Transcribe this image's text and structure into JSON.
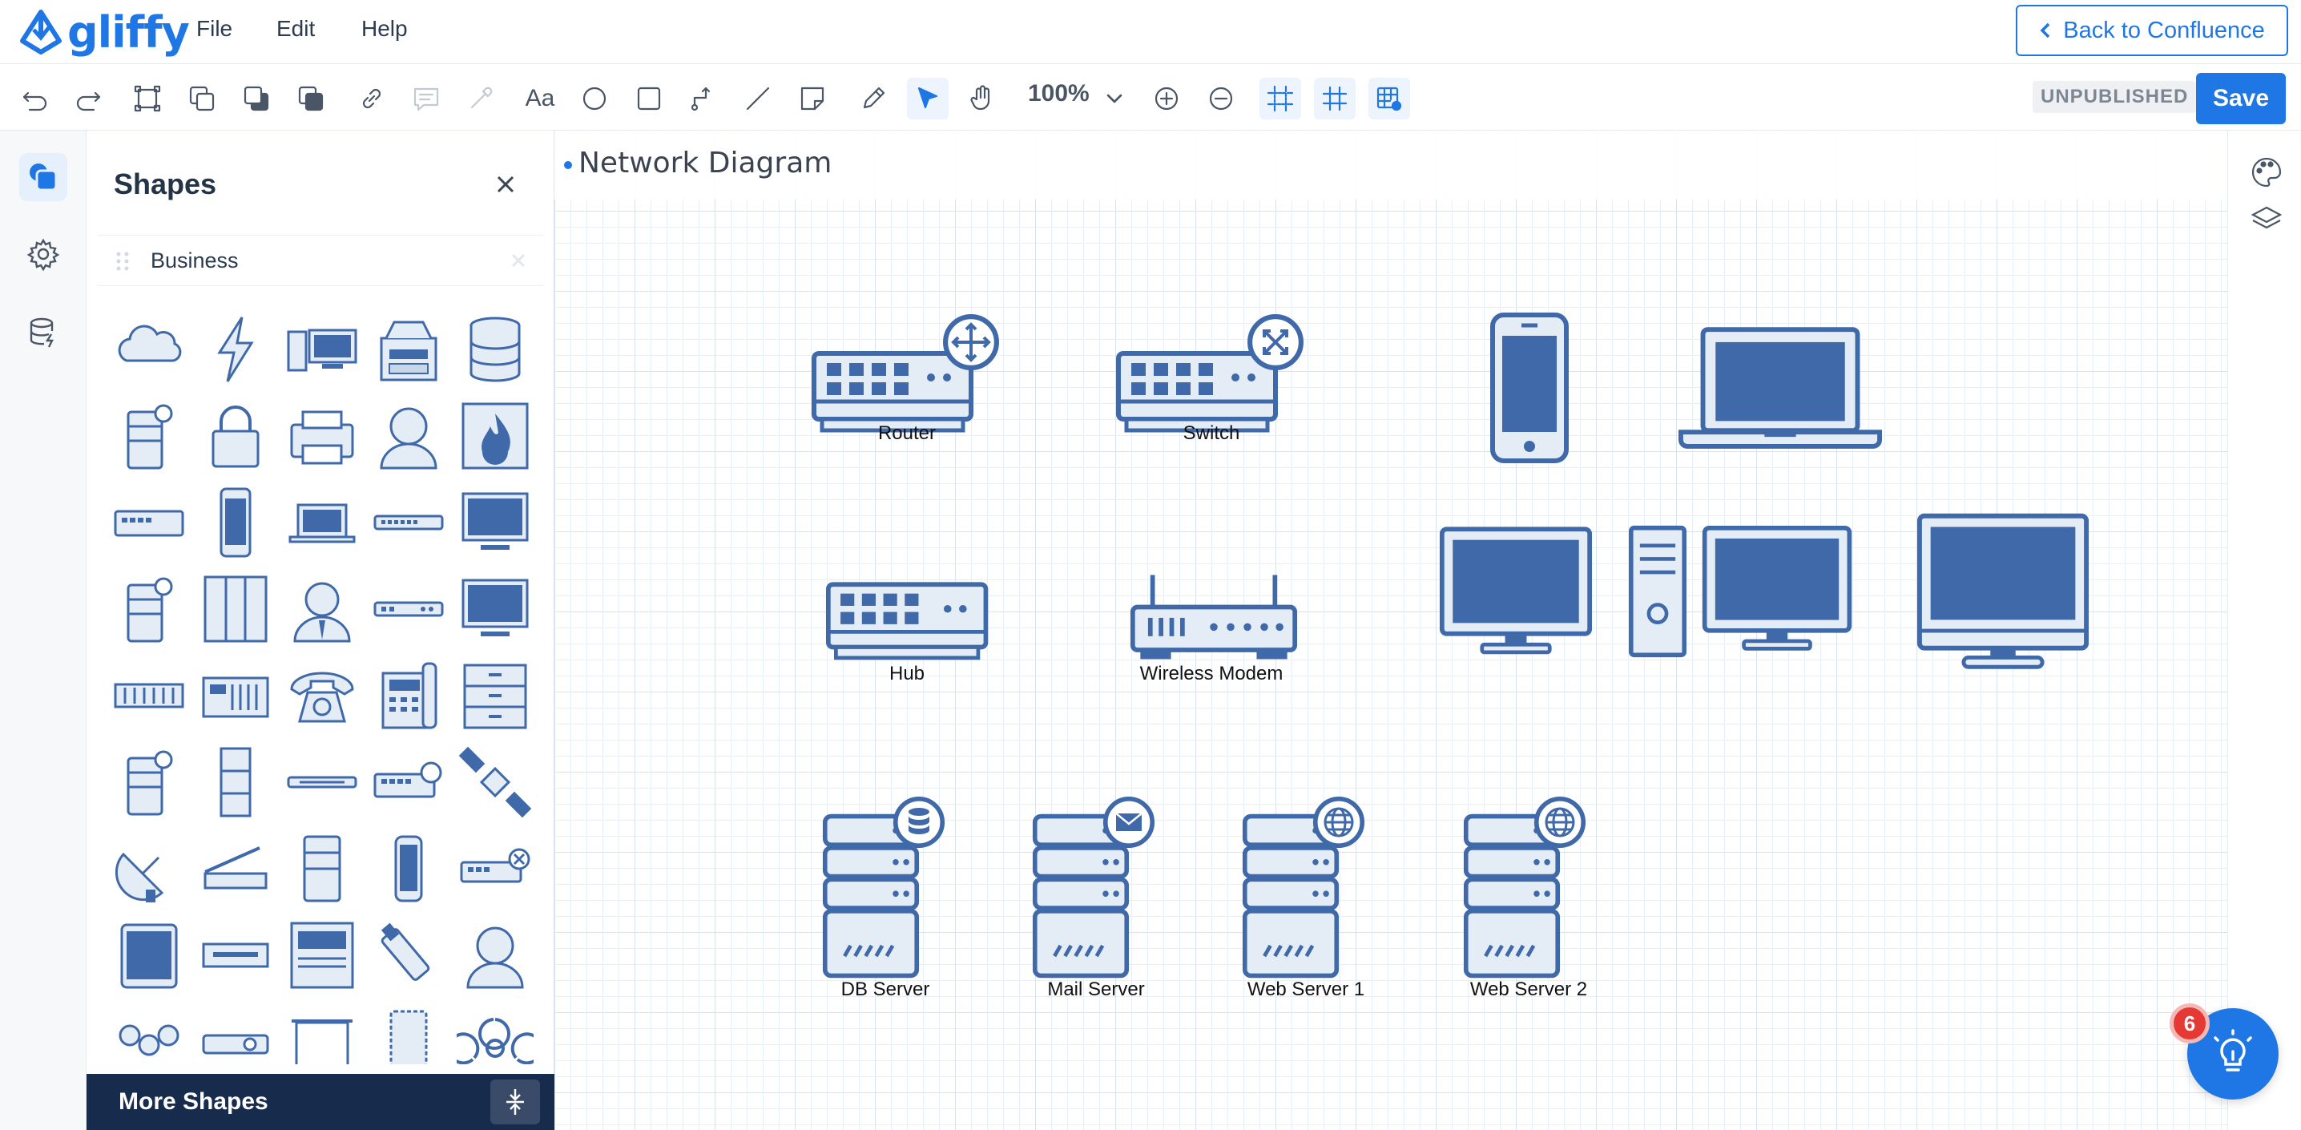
{
  "app": {
    "name": "gliffy"
  },
  "menu": {
    "file": "File",
    "edit": "Edit",
    "help": "Help"
  },
  "header": {
    "back_label": "Back to Confluence"
  },
  "toolbar": {
    "text_tool": "Aa",
    "zoom": "100%",
    "status": "UNPUBLISHED",
    "save_label": "Save"
  },
  "panel": {
    "title": "Shapes",
    "category": "Business",
    "more_shapes": "More Shapes"
  },
  "canvas": {
    "title": "Network Diagram",
    "nodes": {
      "router": "Router",
      "switch": "Switch",
      "hub": "Hub",
      "modem": "Wireless Modem",
      "db": "DB Server",
      "mail": "Mail Server",
      "web1": "Web Server 1",
      "web2": "Web Server 2"
    }
  },
  "notifications": {
    "count": "6"
  },
  "colors": {
    "accent": "#1f77e6",
    "shape": "#3f69a8",
    "panel_footer": "#172b4d"
  }
}
